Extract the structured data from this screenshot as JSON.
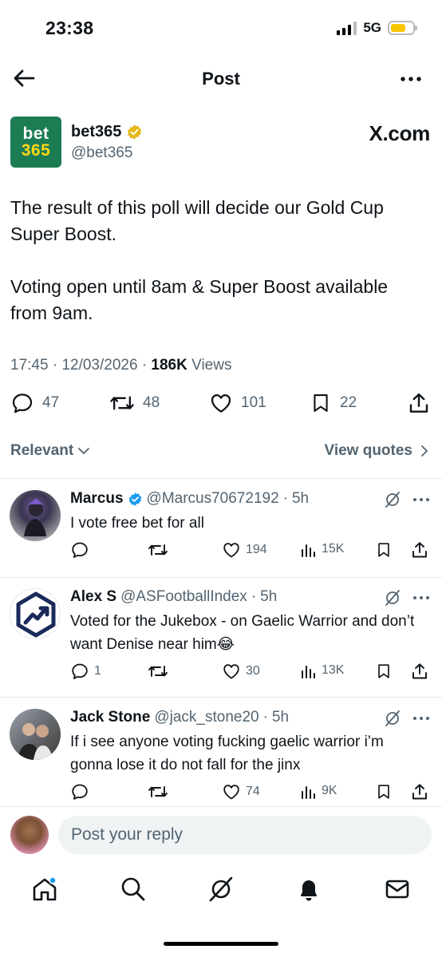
{
  "status_bar": {
    "time": "23:38",
    "network": "5G"
  },
  "header": {
    "title": "Post"
  },
  "post": {
    "author_name": "bet365",
    "author_handle": "@bet365",
    "logo_line1": "bet",
    "logo_line2": "365",
    "badge": "X.com",
    "paragraph1": "The result of this poll will decide our Gold Cup Super Boost.",
    "paragraph2": "Voting open until 8am & Super Boost available from 9am.",
    "time": "17:45",
    "date": "12/03/2026",
    "views_count": "186K",
    "views_label": "Views",
    "stats": {
      "replies": "47",
      "reposts": "48",
      "likes": "101",
      "bookmarks": "22"
    }
  },
  "sort": {
    "relevant_label": "Relevant",
    "view_quotes_label": "View quotes"
  },
  "replies": [
    {
      "name": "Marcus",
      "handle": "@Marcus70672192",
      "time": "5h",
      "verified": true,
      "text": "I vote free bet for all",
      "replies": "",
      "likes": "194",
      "views": "15K"
    },
    {
      "name": "Alex S",
      "handle": "@ASFootballIndex",
      "time": "5h",
      "verified": false,
      "text": "Voted for the Jukebox - on Gaelic Warrior and don’t want Denise near him😂",
      "replies": "1",
      "likes": "30",
      "views": "13K"
    },
    {
      "name": "Jack Stone",
      "handle": "@jack_stone20",
      "time": "5h",
      "verified": false,
      "text": "If i see anyone voting fucking gaelic warrior i’m gonna lose it do not fall for the jinx",
      "replies": "",
      "likes": "74",
      "views": "9K"
    }
  ],
  "reply_box": {
    "placeholder": "Post your reply"
  },
  "nav": [
    "home-icon",
    "search-icon",
    "grok-icon",
    "notifications-icon",
    "messages-icon"
  ],
  "colors": {
    "brand_green": "#1c7c54",
    "brand_yellow": "#ffd814",
    "verified_gold": "#e2b719",
    "verified_blue": "#1d9bf0",
    "muted": "#536471"
  }
}
